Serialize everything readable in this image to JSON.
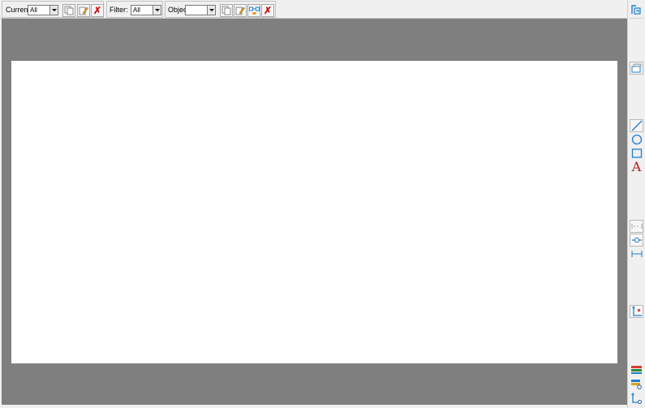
{
  "toolbar": {
    "current": {
      "label": "Current:",
      "value": "All"
    },
    "filter": {
      "label": "Filter:",
      "value": "All"
    },
    "object": {
      "label": "Object:",
      "value": ""
    },
    "delete_glyph": "✗"
  },
  "tool_palette": {
    "text_tool_glyph": "A"
  },
  "colors": {
    "viewport_background": "#7f7f7f",
    "sheet": "#ffffff",
    "accent_blue": "#1f7fd0",
    "delete_red": "#cc1111",
    "text_tool_red": "#b01818"
  },
  "icons": [
    "copy-icon",
    "edit-icon",
    "delete-icon",
    "connect-icon",
    "view-icon",
    "window-icon",
    "line-icon",
    "circle-icon",
    "rectangle-icon",
    "text-icon",
    "horizontal-spacing-icon",
    "link-icon",
    "dimension-icon",
    "axis-icon",
    "layer-icon",
    "layer-settings-icon",
    "tree-icon"
  ]
}
